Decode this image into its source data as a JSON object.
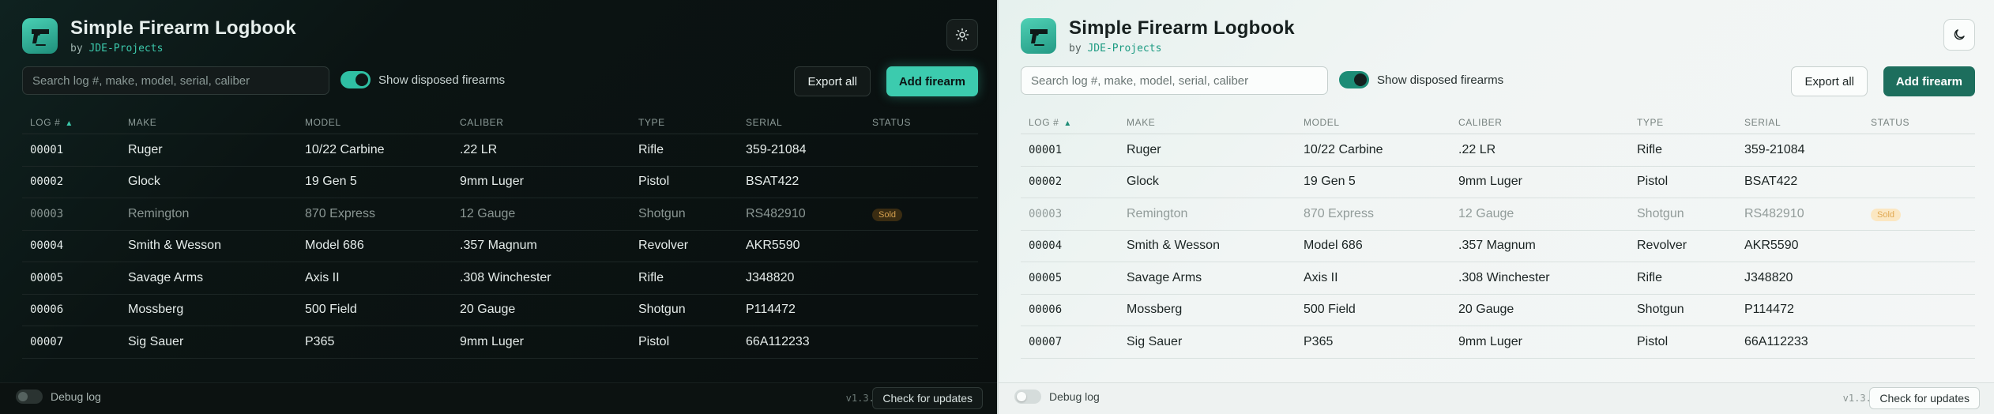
{
  "app": {
    "title": "Simple Firearm Logbook",
    "by_prefix": "by",
    "author": "JDE-Projects"
  },
  "toolbar": {
    "search_placeholder": "Search log #, make, model, serial, caliber",
    "show_disposed_label": "Show disposed firearms",
    "show_disposed_on": true,
    "export_label": "Export all",
    "add_label": "Add firearm"
  },
  "table": {
    "columns": [
      "Log #",
      "Make",
      "Model",
      "Caliber",
      "Type",
      "Serial",
      "Status"
    ],
    "sort_indicator": "▲",
    "rows": [
      {
        "log": "00001",
        "make": "Ruger",
        "model": "10/22 Carbine",
        "caliber": ".22 LR",
        "type": "Rifle",
        "serial": "359-21084",
        "status": ""
      },
      {
        "log": "00002",
        "make": "Glock",
        "model": "19 Gen 5",
        "caliber": "9mm Luger",
        "type": "Pistol",
        "serial": "BSAT422",
        "status": ""
      },
      {
        "log": "00003",
        "make": "Remington",
        "model": "870 Express",
        "caliber": "12 Gauge",
        "type": "Shotgun",
        "serial": "RS482910",
        "status": "Sold"
      },
      {
        "log": "00004",
        "make": "Smith & Wesson",
        "model": "Model 686",
        "caliber": ".357 Magnum",
        "type": "Revolver",
        "serial": "AKR5590",
        "status": ""
      },
      {
        "log": "00005",
        "make": "Savage Arms",
        "model": "Axis II",
        "caliber": ".308 Winchester",
        "type": "Rifle",
        "serial": "J348820",
        "status": ""
      },
      {
        "log": "00006",
        "make": "Mossberg",
        "model": "500 Field",
        "caliber": "20 Gauge",
        "type": "Shotgun",
        "serial": "P114472",
        "status": ""
      },
      {
        "log": "00007",
        "make": "Sig Sauer",
        "model": "P365",
        "caliber": "9mm Luger",
        "type": "Pistol",
        "serial": "66A112233",
        "status": ""
      }
    ]
  },
  "footer": {
    "debug_label": "Debug log",
    "debug_on": false,
    "version": "v1.3.2",
    "update_label": "Check for updates"
  },
  "panels": [
    {
      "theme": "dark",
      "theme_icon": "sun-icon",
      "accent": "#3ccbae"
    },
    {
      "theme": "light",
      "theme_icon": "moon-icon",
      "accent": "#1d6e5d"
    }
  ]
}
